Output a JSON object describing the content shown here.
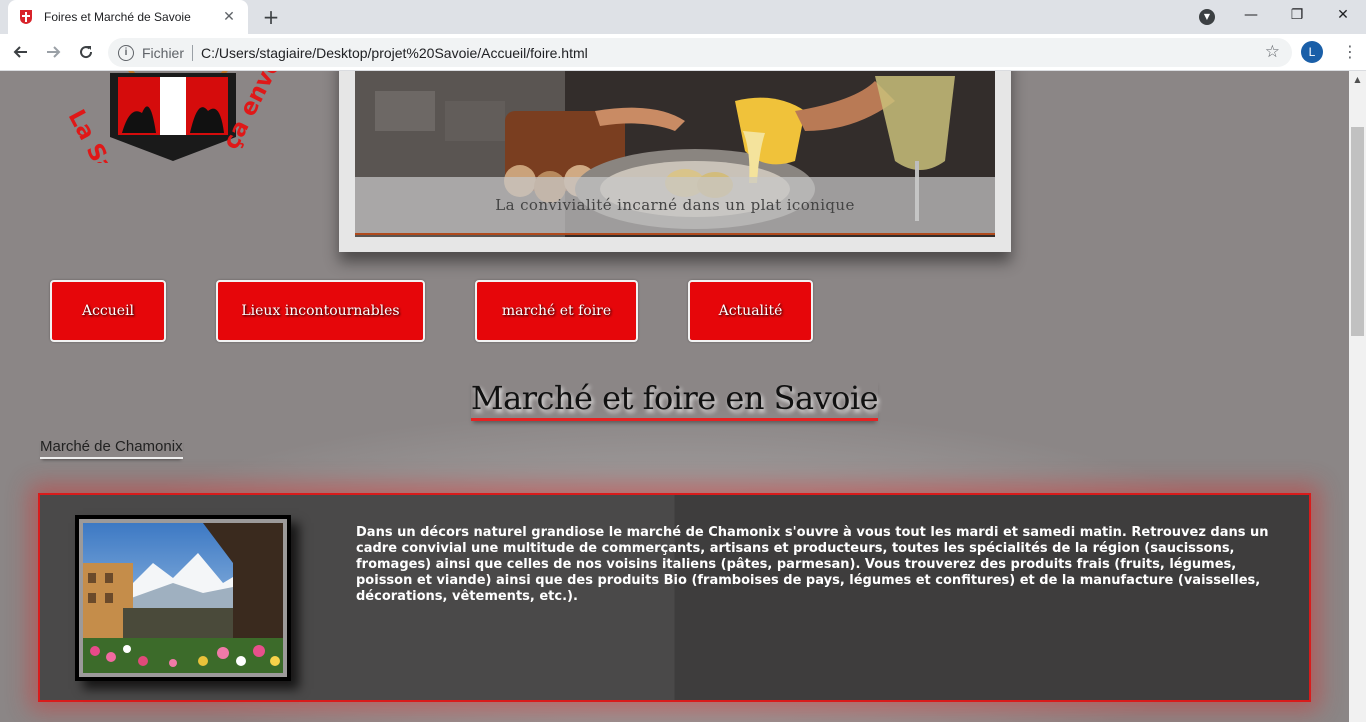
{
  "browser": {
    "tab_title": "Foires et Marché de Savoie",
    "tab_close": "✕",
    "new_tab": "+",
    "address": {
      "scheme": "Fichier",
      "url": "C:/Users/stagiaire/Desktop/projet%20Savoie/Accueil/foire.html"
    },
    "profile_initial": "L",
    "window_controls": {
      "minimize": "—",
      "maximize": "❐",
      "close": "✕"
    },
    "icons": {
      "back": "arrow-left",
      "forward": "arrow-right",
      "reload": "reload",
      "site_info": "info",
      "bookmark": "star",
      "menu": "kebab"
    }
  },
  "page": {
    "logo_text": "La Savoie ça envoie",
    "hero_caption": "La convivialité incarné dans un plat iconique",
    "nav": [
      {
        "label": "Accueil"
      },
      {
        "label": "Lieux incontournables"
      },
      {
        "label": "marché et foire"
      },
      {
        "label": "Actualité"
      }
    ],
    "title": "Marché et foire en Savoie",
    "section_title": "Marché de Chamonix",
    "card_text": "Dans un décors naturel grandiose le marché de Chamonix s'ouvre à vous tout les mardi et samedi matin. Retrouvez dans un cadre convivial une multitude de commerçants, artisans et producteurs, toutes les spécialités de la région (saucissons, fromages) ainsi que celles de nos voisins italiens (pâtes, parmesan). Vous trouverez des produits frais (fruits, légumes, poisson et viande) ainsi que des produits Bio (framboises de pays, légumes et confitures) et de la manufacture (vaisselles, décorations, vêtements, etc.)."
  },
  "colors": {
    "nav_button": "#e6060a",
    "title_underline": "#e52222",
    "card_border": "#d91b1b",
    "page_bg": "#8b8686"
  }
}
